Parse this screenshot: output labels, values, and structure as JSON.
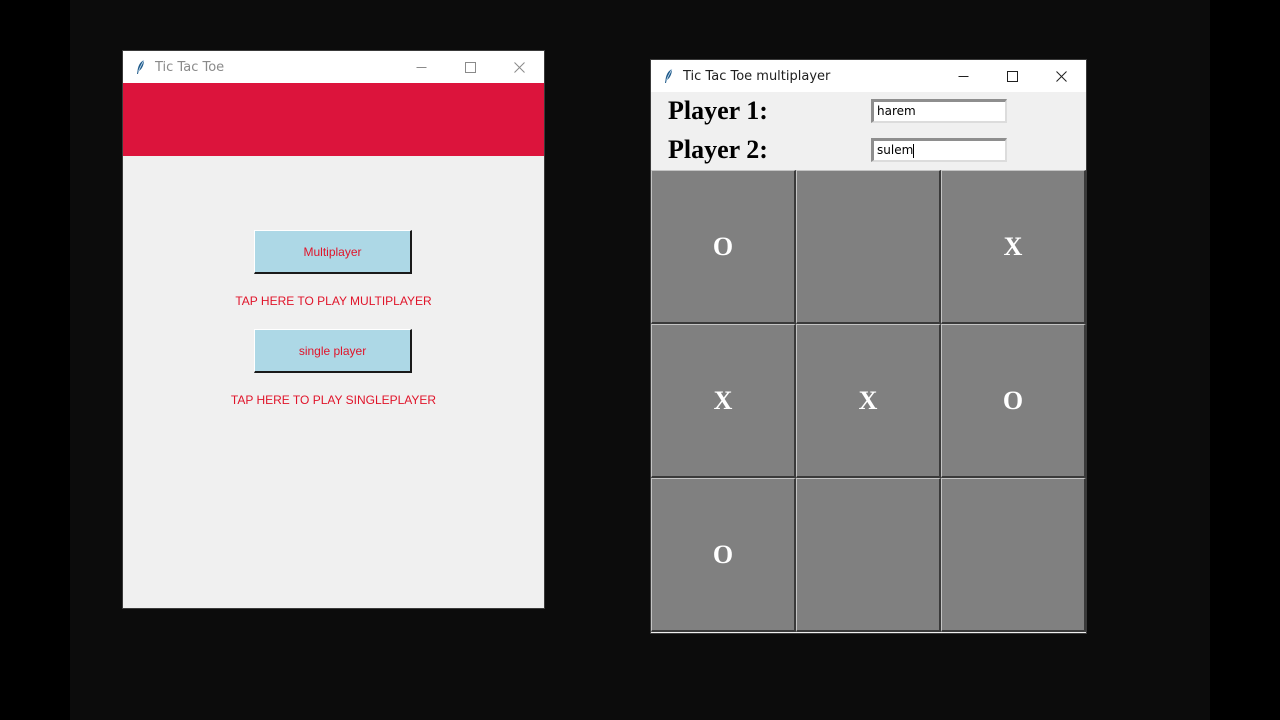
{
  "colors": {
    "desktop": "#0c0c0c",
    "banner": "#dc143c",
    "button_bg": "#add8e6",
    "button_text": "#e0142a",
    "cell_bg": "#808080",
    "cell_text": "#ffffff"
  },
  "window_main": {
    "title": "Tic Tac Toe",
    "icon": "feather-icon",
    "controls": {
      "minimize": "minimize-icon",
      "maximize": "maximize-icon",
      "close": "close-icon"
    },
    "multiplayer_button": "Multiplayer",
    "multiplayer_hint": "TAP HERE TO PLAY MULTIPLAYER",
    "singleplayer_button": "single player",
    "singleplayer_hint": "TAP HERE TO PLAY SINGLEPLAYER"
  },
  "window_multi": {
    "title": "Tic Tac Toe multiplayer",
    "icon": "feather-icon",
    "controls": {
      "minimize": "minimize-icon",
      "maximize": "maximize-icon",
      "close": "close-icon"
    },
    "player1_label": "Player 1:",
    "player1_value": "harem",
    "player2_label": "Player 2:",
    "player2_value": "sulem",
    "board": [
      [
        "O",
        "",
        "X"
      ],
      [
        "X",
        "X",
        "O"
      ],
      [
        "O",
        "",
        ""
      ]
    ]
  }
}
